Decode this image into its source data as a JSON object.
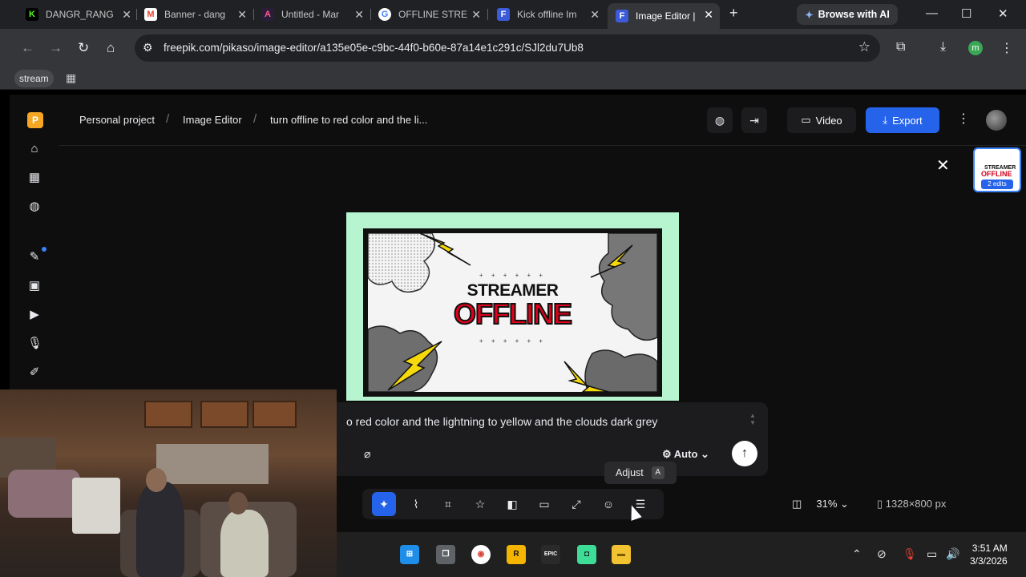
{
  "browser": {
    "tabs": [
      {
        "label": "DANGR_RANG",
        "fav": "K",
        "fav_color": "#53fc18"
      },
      {
        "label": "Banner - dang",
        "fav": "M",
        "fav_color": "#ea4335"
      },
      {
        "label": "Untitled - Mar",
        "fav": "A",
        "fav_color": "#2b1d3a"
      },
      {
        "label": "OFFLINE STRE",
        "fav": "G",
        "fav_color": "#ffffff"
      },
      {
        "label": "Kick offline Im",
        "fav": "F",
        "fav_color": "#3b5bdb"
      },
      {
        "label": "Image Editor |",
        "fav": "F",
        "fav_color": "#3b5bdb"
      }
    ],
    "browse_ai": "Browse with AI",
    "url": "freepik.com/pikaso/image-editor/a135e05e-c9bc-44f0-b60e-87a14e1c291c/SJl2du7Ub8",
    "profile_initial": "m",
    "bookmark": "stream"
  },
  "app": {
    "logo": "P",
    "breadcrumbs": [
      "Personal project",
      "Image Editor",
      "turn offline to red color and the li..."
    ],
    "video_label": "Video",
    "export_label": "Export",
    "thumb": {
      "title": "STREAMER",
      "subtitle": "OFFLINE",
      "badge": "2 edits"
    },
    "banner": {
      "title1": "STREAMER",
      "title2": "OFFLINE",
      "dots": "+ + + + + +"
    },
    "prompt_text": "o red color and the lightning to yellow and the clouds dark grey",
    "auto_label": "Auto",
    "tooltip": {
      "label": "Adjust",
      "key": "A"
    },
    "zoom": "31%",
    "dimensions": "1328×800 px"
  },
  "taskbar": {
    "time": "3:51 AM",
    "date": "3/3/2026"
  },
  "colors": {
    "accent": "#2563eb",
    "offline_red": "#e2001a",
    "canvas_bg": "#b7f5d0"
  }
}
